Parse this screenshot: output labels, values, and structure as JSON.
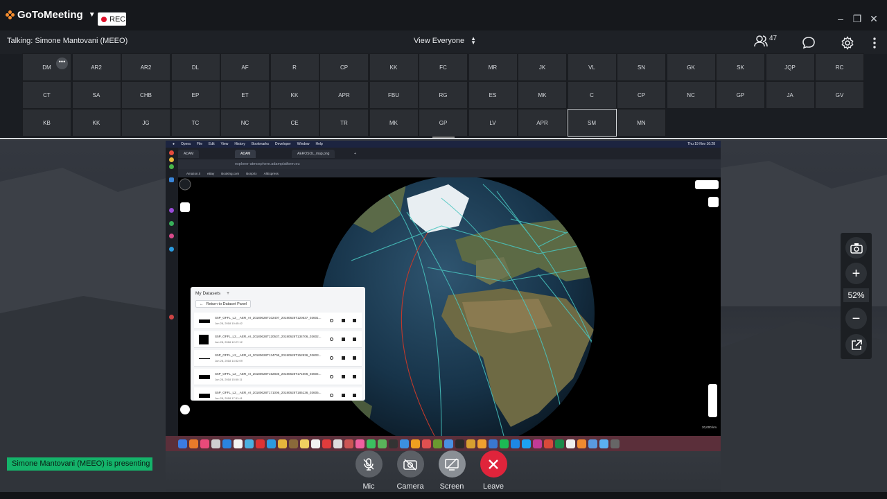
{
  "app": {
    "name": "GoToMeeting",
    "rec_label": "REC",
    "window_controls": [
      "–",
      "❐",
      "✕"
    ]
  },
  "info": {
    "talking": "Talking: Simone Mantovani (MEEO)",
    "view_label": "View Everyone",
    "attendee_count": "47"
  },
  "attendees": [
    [
      "DM",
      "AR2",
      "AR2",
      "DL",
      "AF",
      "R",
      "CP",
      "KK",
      "FC",
      "MR",
      "JK",
      "VL",
      "SN",
      "GK",
      "SK",
      "JQP",
      "RC"
    ],
    [
      "CT",
      "SA",
      "CHB",
      "EP",
      "ET",
      "KK",
      "APR",
      "FBU",
      "RG",
      "ES",
      "MK",
      "C",
      "CP",
      "NC",
      "GP",
      "JA",
      "GV"
    ],
    [
      "KB",
      "KK",
      "JG",
      "TC",
      "NC",
      "CE",
      "TR",
      "MK",
      "GP",
      "LV",
      "APR",
      "SM",
      "MN"
    ]
  ],
  "attendee_more": "•••",
  "shared_screen": {
    "mac_menu": [
      "Opera",
      "File",
      "Edit",
      "View",
      "History",
      "Bookmarks",
      "Developer",
      "Window",
      "Help"
    ],
    "mac_time": "Thu 19 Nov 16:28",
    "tabs": [
      "ADAM",
      "ADAM",
      "AEROSOL_map.png",
      "+"
    ],
    "url": "explorer-atmosphere.adamplatform.eu",
    "bookmarks": [
      "Amazon.it",
      "eBay",
      "Booking.com",
      "Bonprix",
      "AliExpress"
    ],
    "panel": {
      "title": "My Datasets",
      "add": "+",
      "return_label": "Return to Dataset Panel",
      "datasets": [
        {
          "name": "S5P_OFFL_L2__AER_AI_20180628T102407_20180628T120537_03601...",
          "date": "Jun 28, 2018 10:45:42"
        },
        {
          "name": "S5P_OFFL_L2__AER_AI_20180628T120537_20180628T134706_03602...",
          "date": "Jun 28, 2018 12:27:12"
        },
        {
          "name": "S5P_OFFL_L2__AER_AI_20180628T134706_20180628T152836_03603...",
          "date": "Jun 28, 2018 14:52:09"
        },
        {
          "name": "S5P_OFFL_L2__AER_AI_20180628T152836_20180628T171006_03604...",
          "date": "Jun 28, 2018 15:50:11"
        },
        {
          "name": "S5P_OFFL_L2__AER_AI_20180628T171006_20180628T185136_03605...",
          "date": "Jun 28, 2018 17:31:41"
        }
      ]
    },
    "scale": "20,000 km"
  },
  "zoom": {
    "plus": "+",
    "minus": "−",
    "level": "52%"
  },
  "presenting": "Simone Mantovani (MEEO) is presenting",
  "controls": {
    "mic": "Mic",
    "camera": "Camera",
    "screen": "Screen",
    "leave": "Leave"
  }
}
